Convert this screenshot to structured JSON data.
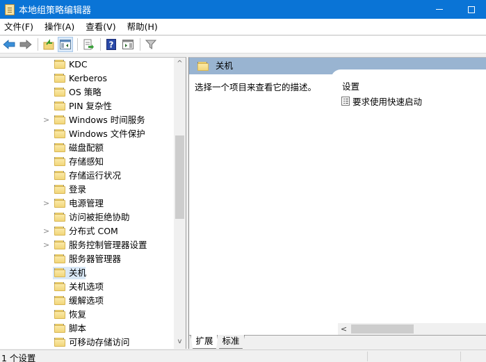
{
  "window": {
    "title": "本地组策略编辑器",
    "controls": {
      "minimize": "minimize",
      "maximize": "maximize"
    }
  },
  "menubar": {
    "items": [
      "文件(F)",
      "操作(A)",
      "查看(V)",
      "帮助(H)"
    ]
  },
  "toolbar": {
    "buttons": [
      "back-icon",
      "forward-icon",
      "up-folder-icon",
      "show-hide-tree-icon",
      "export-list-icon",
      "help-icon",
      "show-hide-action-pane-icon",
      "filter-icon"
    ]
  },
  "tree": {
    "items": [
      {
        "label": "KDC",
        "expandable": false
      },
      {
        "label": "Kerberos",
        "expandable": false
      },
      {
        "label": "OS 策略",
        "expandable": false
      },
      {
        "label": "PIN 复杂性",
        "expandable": false
      },
      {
        "label": "Windows 时间服务",
        "expandable": true
      },
      {
        "label": "Windows 文件保护",
        "expandable": false
      },
      {
        "label": "磁盘配额",
        "expandable": false
      },
      {
        "label": "存储感知",
        "expandable": false
      },
      {
        "label": "存储运行状况",
        "expandable": false
      },
      {
        "label": "登录",
        "expandable": false
      },
      {
        "label": "电源管理",
        "expandable": true
      },
      {
        "label": "访问被拒绝协助",
        "expandable": false
      },
      {
        "label": "分布式 COM",
        "expandable": true
      },
      {
        "label": "服务控制管理器设置",
        "expandable": true
      },
      {
        "label": "服务器管理器",
        "expandable": false
      },
      {
        "label": "关机",
        "expandable": false,
        "selected": true
      },
      {
        "label": "关机选项",
        "expandable": false
      },
      {
        "label": "缓解选项",
        "expandable": false
      },
      {
        "label": "恢复",
        "expandable": false
      },
      {
        "label": "脚本",
        "expandable": false
      },
      {
        "label": "可移动存储访问",
        "expandable": false
      }
    ],
    "scroll_up": "^",
    "scroll_down": "v",
    "expand_glyph": ">"
  },
  "details": {
    "header_title": "关机",
    "description": "选择一个项目来查看它的描述。",
    "column_header": "设置",
    "settings": [
      "要求使用快速启动"
    ],
    "hscroll_left": "<",
    "tabs": [
      "扩展",
      "标准"
    ],
    "active_tab": "扩展"
  },
  "statusbar": {
    "text": "1 个设置"
  }
}
